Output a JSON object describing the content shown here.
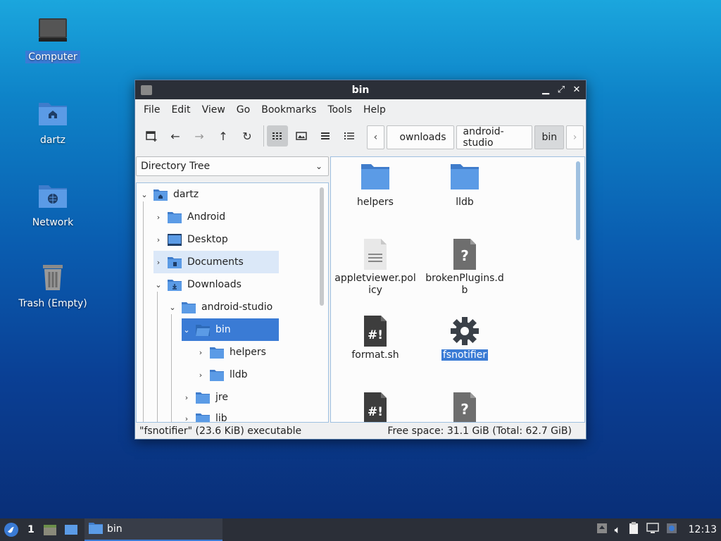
{
  "desktop": {
    "icons": [
      {
        "label": "Computer"
      },
      {
        "label": "dartz"
      },
      {
        "label": "Network"
      },
      {
        "label": "Trash (Empty)"
      }
    ]
  },
  "window": {
    "title": "bin",
    "menu": [
      "File",
      "Edit",
      "View",
      "Go",
      "Bookmarks",
      "Tools",
      "Help"
    ],
    "breadcrumbs": [
      "ownloads",
      "android-studio",
      "bin"
    ],
    "left_panel_mode": "Directory Tree",
    "tree": [
      {
        "label": "dartz"
      },
      {
        "label": "Android"
      },
      {
        "label": "Desktop"
      },
      {
        "label": "Documents"
      },
      {
        "label": "Downloads"
      },
      {
        "label": "android-studio"
      },
      {
        "label": "bin"
      },
      {
        "label": "helpers"
      },
      {
        "label": "lldb"
      },
      {
        "label": "jre"
      },
      {
        "label": "lib"
      }
    ],
    "files": [
      {
        "name": "helpers",
        "icon": "folder-icon"
      },
      {
        "name": "lldb",
        "icon": "folder-icon"
      },
      {
        "name": "appletviewer.policy",
        "icon": "text-file-icon"
      },
      {
        "name": "brokenPlugins.db",
        "icon": "unknown-file-icon"
      },
      {
        "name": "format.sh",
        "icon": "script-icon"
      },
      {
        "name": "fsnotifier",
        "icon": "gear-icon"
      },
      {
        "name": "",
        "icon": "script-icon"
      },
      {
        "name": "",
        "icon": "unknown-file-icon"
      }
    ],
    "status_left": "\"fsnotifier\" (23.6 KiB) executable",
    "status_right": "Free space: 31.1 GiB (Total: 62.7 GiB)"
  },
  "taskbar": {
    "workspace": "1",
    "task_label": "bin",
    "clock": "12:13"
  },
  "colors": {
    "accent": "#3a7bd5",
    "folder": "#4a8ad8",
    "titlebar": "#2b2f38"
  }
}
